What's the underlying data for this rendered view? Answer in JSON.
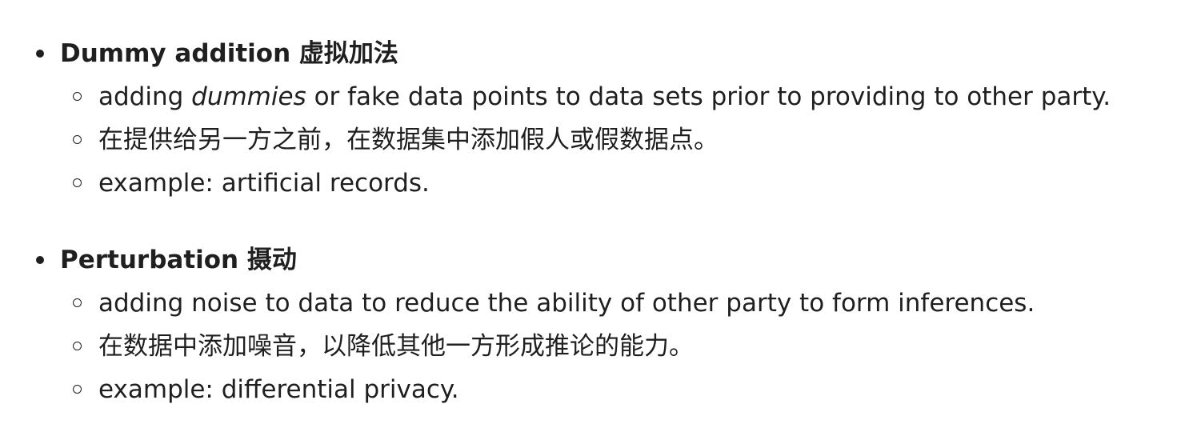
{
  "sections": [
    {
      "heading": "Dummy addition 虚拟加法",
      "items": [
        {
          "before": "adding ",
          "emphasis": "dummies",
          "after": " or fake data points to data sets prior to providing to other party."
        },
        {
          "text": "在提供给另一方之前，在数据集中添加假人或假数据点。"
        },
        {
          "text": "example: artificial records."
        }
      ]
    },
    {
      "heading": "Perturbation 摄动",
      "items": [
        {
          "text": "adding noise to data to reduce the ability of other party to form inferences."
        },
        {
          "text": "在数据中添加噪音，以降低其他一方形成推论的能力。"
        },
        {
          "text": "example: differential privacy."
        }
      ]
    }
  ]
}
